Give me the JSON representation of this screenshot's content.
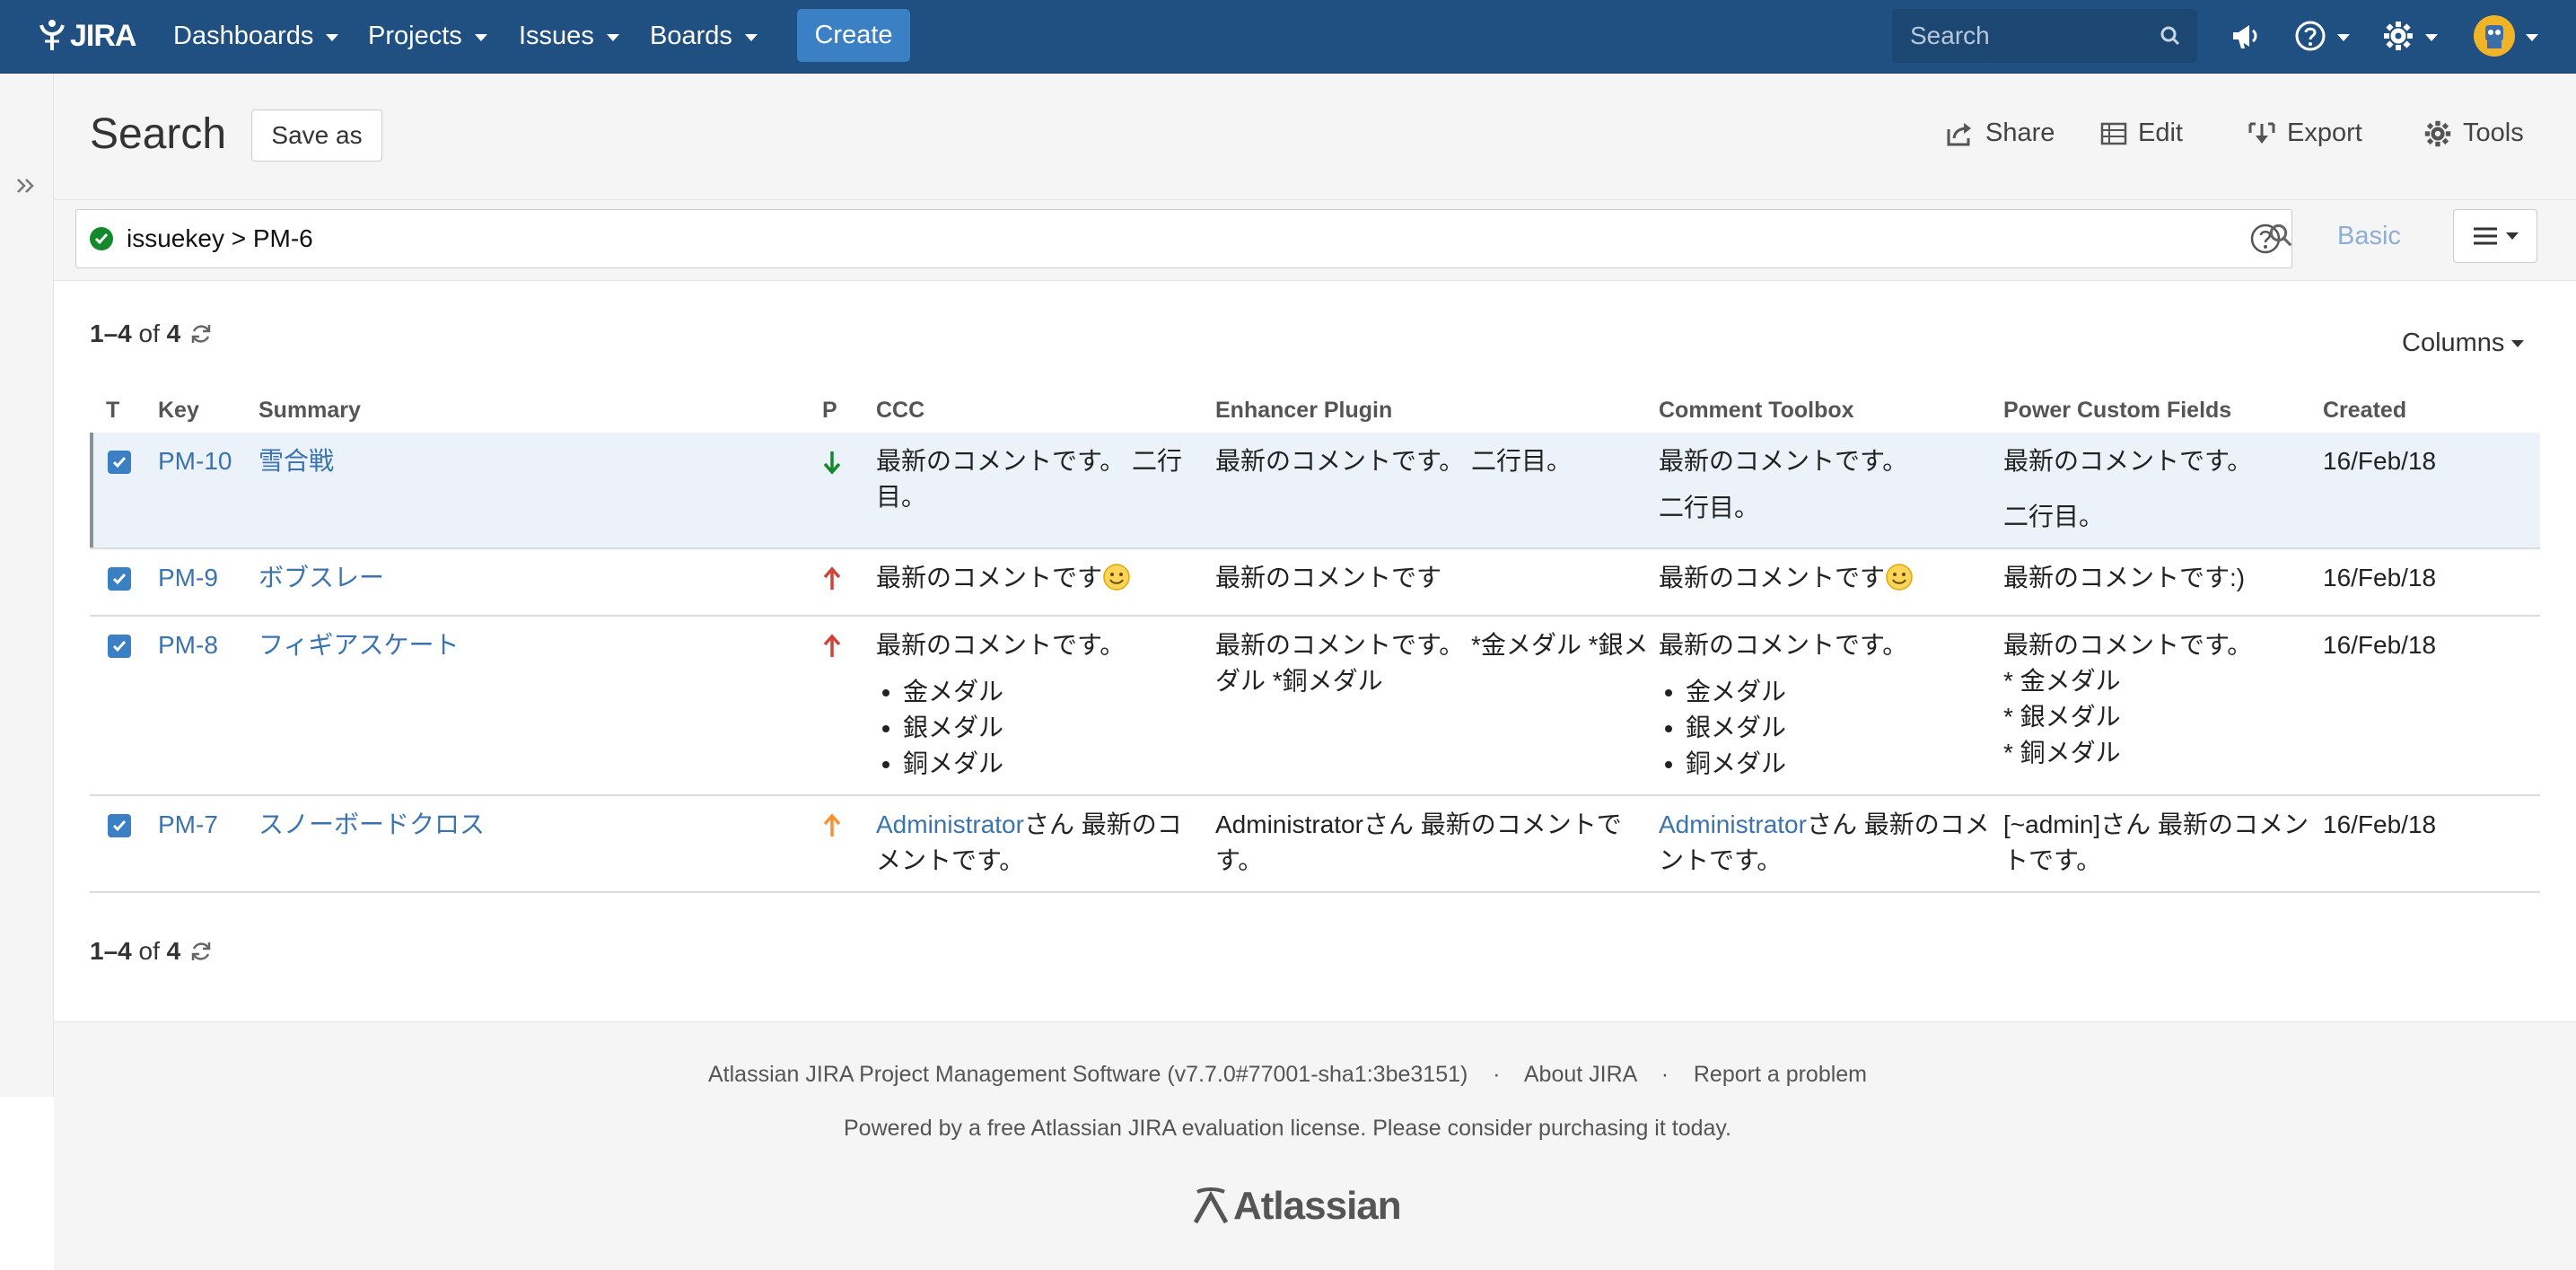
{
  "nav": {
    "logo_text": "JIRA",
    "items": [
      {
        "label": "Dashboards"
      },
      {
        "label": "Projects"
      },
      {
        "label": "Issues"
      },
      {
        "label": "Boards"
      }
    ],
    "create_label": "Create",
    "search_placeholder": "Search"
  },
  "header": {
    "title": "Search",
    "save_as": "Save as",
    "share": "Share",
    "edit": "Edit",
    "export": "Export",
    "tools": "Tools"
  },
  "jql": {
    "query": "issuekey > PM-6",
    "basic_label": "Basic"
  },
  "results": {
    "count_range": "1–4",
    "count_of": "of",
    "count_total": "4",
    "columns_label": "Columns",
    "headers": [
      "T",
      "Key",
      "Summary",
      "P",
      "CCC",
      "Enhancer Plugin",
      "Comment Toolbox",
      "Power Custom Fields",
      "Created"
    ],
    "rows": [
      {
        "key": "PM-10",
        "summary": "雪合戦",
        "priority": "low",
        "ccc": "最新のコメントです。 二行目。",
        "enhancer": "最新のコメントです。 二行目。",
        "toolbox_line1": "最新のコメントです。",
        "toolbox_line2": "二行目。",
        "power_line1": "最新のコメントです。",
        "power_line2": "二行目。",
        "created": "16/Feb/18"
      },
      {
        "key": "PM-9",
        "summary": "ボブスレー",
        "priority": "high",
        "ccc": "最新のコメントです",
        "enhancer": "最新のコメントです",
        "toolbox": "最新のコメントです",
        "power": "最新のコメントです:)",
        "created": "16/Feb/18"
      },
      {
        "key": "PM-8",
        "summary": "フィギアスケート",
        "priority": "high",
        "ccc_intro": "最新のコメントです。",
        "ccc_list": [
          "金メダル",
          "銀メダル",
          "銅メダル"
        ],
        "enhancer": "最新のコメントです。 *金メダル *銀メダル *銅メダル",
        "toolbox_intro": "最新のコメントです。",
        "toolbox_list": [
          "金メダル",
          "銀メダル",
          "銅メダル"
        ],
        "power_lines": [
          "最新のコメントです。",
          "* 金メダル",
          "* 銀メダル",
          "* 銅メダル"
        ],
        "created": "16/Feb/18"
      },
      {
        "key": "PM-7",
        "summary": "スノーボードクロス",
        "priority": "medium",
        "ccc_user": "Administrator",
        "ccc_rest": "さん 最新のコメントです。",
        "enhancer": "Administratorさん 最新のコメントです。",
        "toolbox_user": "Administrator",
        "toolbox_rest": "さん 最新のコメントです。",
        "power": "[~admin]さん 最新のコメントです。",
        "created": "16/Feb/18"
      }
    ]
  },
  "footer": {
    "software": "Atlassian JIRA Project Management Software (v7.7.0#77001-sha1:3be3151)",
    "sep": "·",
    "about": "About JIRA",
    "report": "Report a problem",
    "license": "Powered by a free Atlassian JIRA evaluation license. Please consider purchasing it today.",
    "atlassian": "Atlassian"
  },
  "colors": {
    "nav_bg": "#205081",
    "create_bg": "#3b7fc4",
    "link": "#3b73af",
    "priority_high": "#d04437",
    "priority_medium": "#f79232",
    "priority_low": "#14892c"
  },
  "icons": [
    "jira-logo-icon",
    "search-icon",
    "megaphone-icon",
    "help-icon",
    "gear-icon",
    "avatar",
    "expand-sidebar-icon",
    "share-icon",
    "edit-icon",
    "export-icon",
    "tools-icon",
    "valid-query-icon",
    "refresh-icon",
    "checkbox-icon",
    "priority-arrow-icon",
    "smiley-icon",
    "hamburger-icon",
    "atlassian-logo-icon"
  ]
}
